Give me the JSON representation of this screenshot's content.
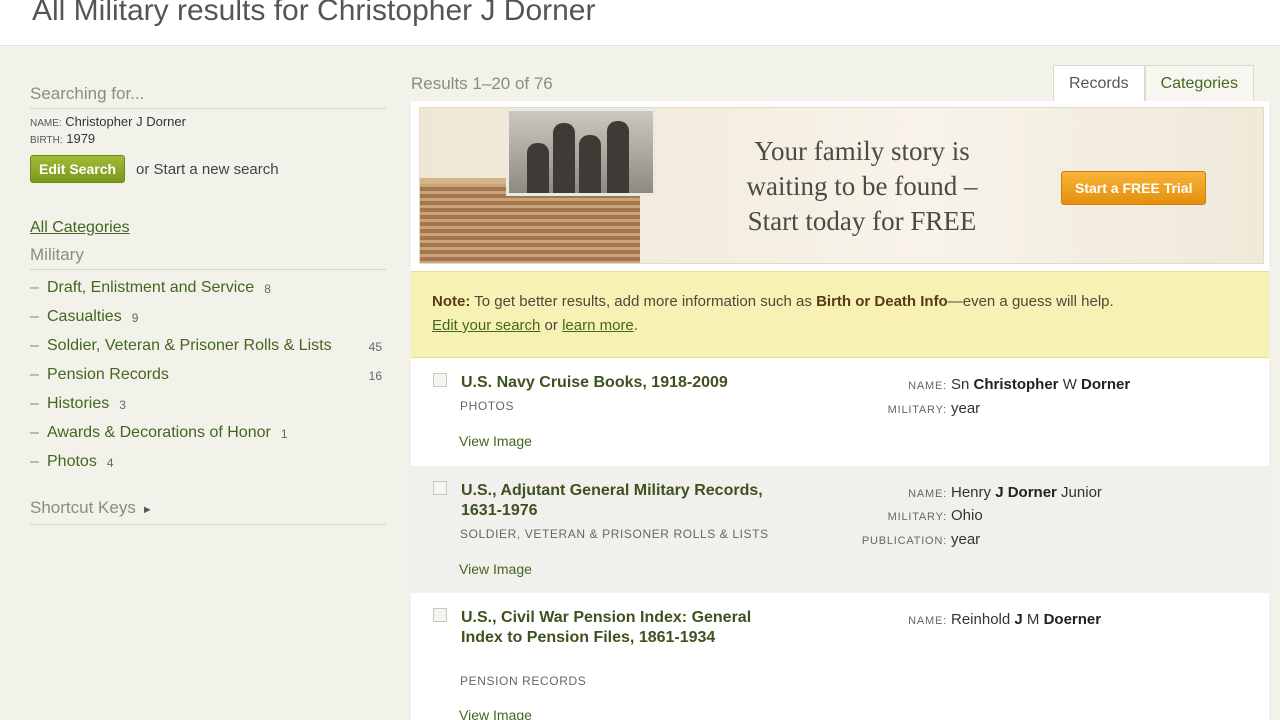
{
  "page": {
    "title": "All Military results for Christopher J Dorner"
  },
  "sidebar": {
    "searching_for": "Searching for...",
    "criteria": [
      {
        "label": "NAME:",
        "value": "Christopher J Dorner"
      },
      {
        "label": "BIRTH:",
        "value": "1979"
      }
    ],
    "edit_search_label": "Edit Search",
    "new_search_text": "or Start a new search",
    "all_categories": "All Categories",
    "section_title": "Military",
    "categories": [
      {
        "name": "Draft, Enlistment and Service",
        "count": "8"
      },
      {
        "name": "Casualties",
        "count": "9"
      },
      {
        "name": "Soldier, Veteran & Prisoner Rolls & Lists",
        "count": "45"
      },
      {
        "name": "Pension Records",
        "count": "16"
      },
      {
        "name": "Histories",
        "count": "3"
      },
      {
        "name": "Awards & Decorations of Honor",
        "count": "1"
      },
      {
        "name": "Photos",
        "count": "4"
      }
    ],
    "shortcut_keys": "Shortcut Keys"
  },
  "results": {
    "count_text": "Results 1–20 of 76",
    "tabs": [
      {
        "label": "Records",
        "active": true
      },
      {
        "label": "Categories",
        "active": false
      }
    ]
  },
  "banner": {
    "text_line1": "Your family story is",
    "text_line2": "waiting to be found –",
    "text_line3": "Start today for FREE",
    "cta_label": "Start a FREE Trial"
  },
  "note": {
    "label": "Note:",
    "text1": " To get better results, add more information such as ",
    "strong": "Birth or Death Info",
    "text2": "—even a guess will help.",
    "link1": "Edit your search",
    "text3": " or ",
    "link2": "learn more",
    "text4": "."
  },
  "records": [
    {
      "title": "U.S. Navy Cruise Books, 1918-2009",
      "category": "PHOTOS",
      "view": "View Image",
      "fields": [
        {
          "key": "NAME:",
          "pre": "Sn ",
          "bold": "Christopher",
          "mid": " W ",
          "bold2": "Dorner",
          "post": ""
        },
        {
          "key": "MILITARY:",
          "pre": "year",
          "bold": "",
          "mid": "",
          "bold2": "",
          "post": ""
        }
      ]
    },
    {
      "title": "U.S., Adjutant General Military Records, 1631-1976",
      "category": "SOLDIER, VETERAN & PRISONER ROLLS & LISTS",
      "view": "View Image",
      "fields": [
        {
          "key": "NAME:",
          "pre": "Henry ",
          "bold": "J",
          "mid": " ",
          "bold2": "Dorner",
          "post": " Junior"
        },
        {
          "key": "MILITARY:",
          "pre": "Ohio",
          "bold": "",
          "mid": "",
          "bold2": "",
          "post": ""
        },
        {
          "key": "PUBLICATION:",
          "pre": "year",
          "bold": "",
          "mid": "",
          "bold2": "",
          "post": ""
        }
      ]
    },
    {
      "title": "U.S., Civil War Pension Index: General Index to Pension Files, 1861-1934",
      "category": "PENSION RECORDS",
      "view": "View Image",
      "fields": [
        {
          "key": "NAME:",
          "pre": "Reinhold ",
          "bold": "J",
          "mid": " M ",
          "bold2": "Doerner",
          "post": ""
        }
      ]
    }
  ]
}
